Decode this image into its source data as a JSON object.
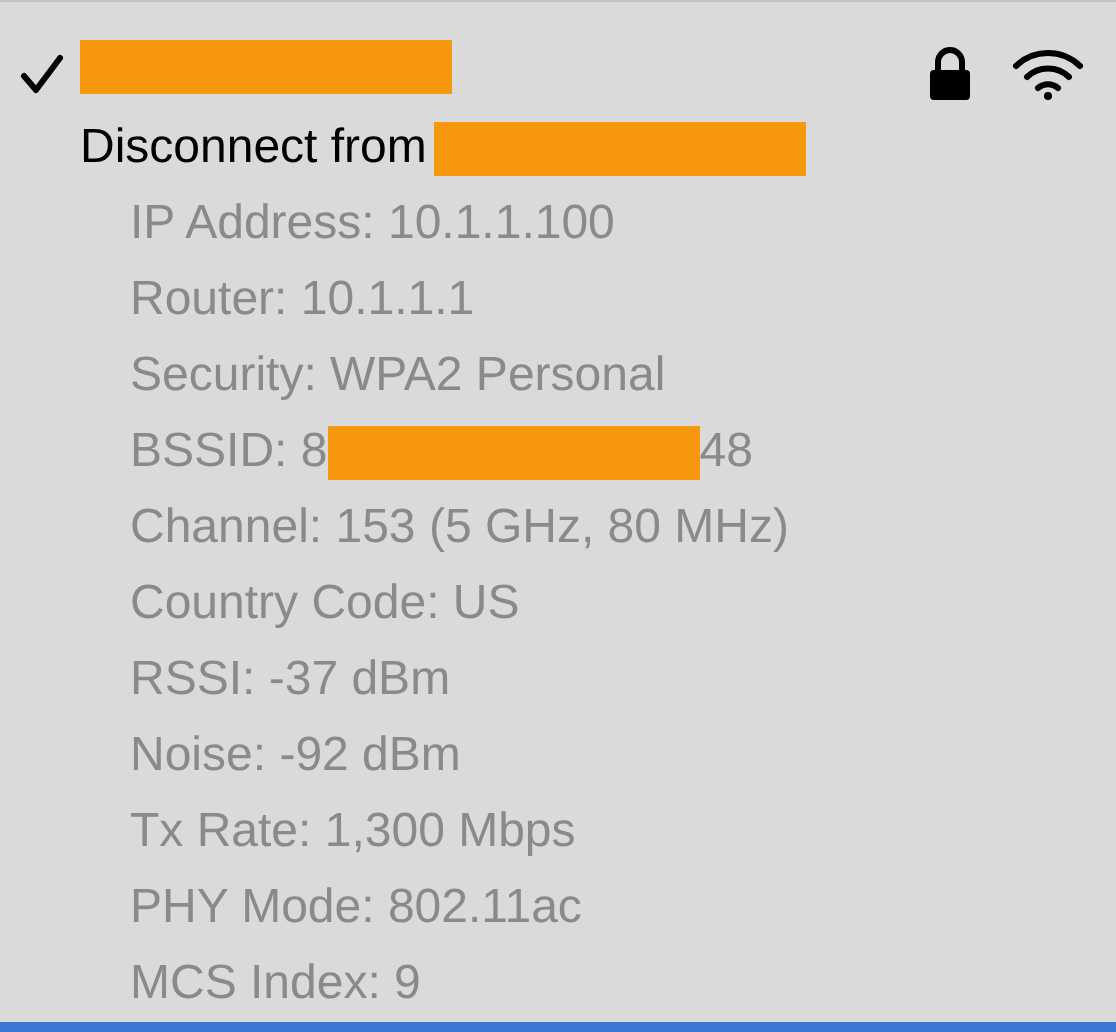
{
  "network": {
    "checked": true,
    "locked": true
  },
  "disconnect": {
    "label": "Disconnect from"
  },
  "details": [
    {
      "kind": "text",
      "text": "IP Address: 10.1.1.100"
    },
    {
      "kind": "text",
      "text": "Router: 10.1.1.1"
    },
    {
      "kind": "text",
      "text": "Security: WPA2 Personal"
    },
    {
      "kind": "redacted",
      "prefix": "BSSID: 8",
      "suffix": "48"
    },
    {
      "kind": "text",
      "text": "Channel: 153 (5 GHz, 80 MHz)"
    },
    {
      "kind": "text",
      "text": "Country Code: US"
    },
    {
      "kind": "text",
      "text": "RSSI: -37 dBm"
    },
    {
      "kind": "text",
      "text": "Noise: -92 dBm"
    },
    {
      "kind": "text",
      "text": "Tx Rate: 1,300 Mbps"
    },
    {
      "kind": "text",
      "text": "PHY Mode: 802.11ac"
    },
    {
      "kind": "text",
      "text": "MCS Index: 9"
    }
  ]
}
